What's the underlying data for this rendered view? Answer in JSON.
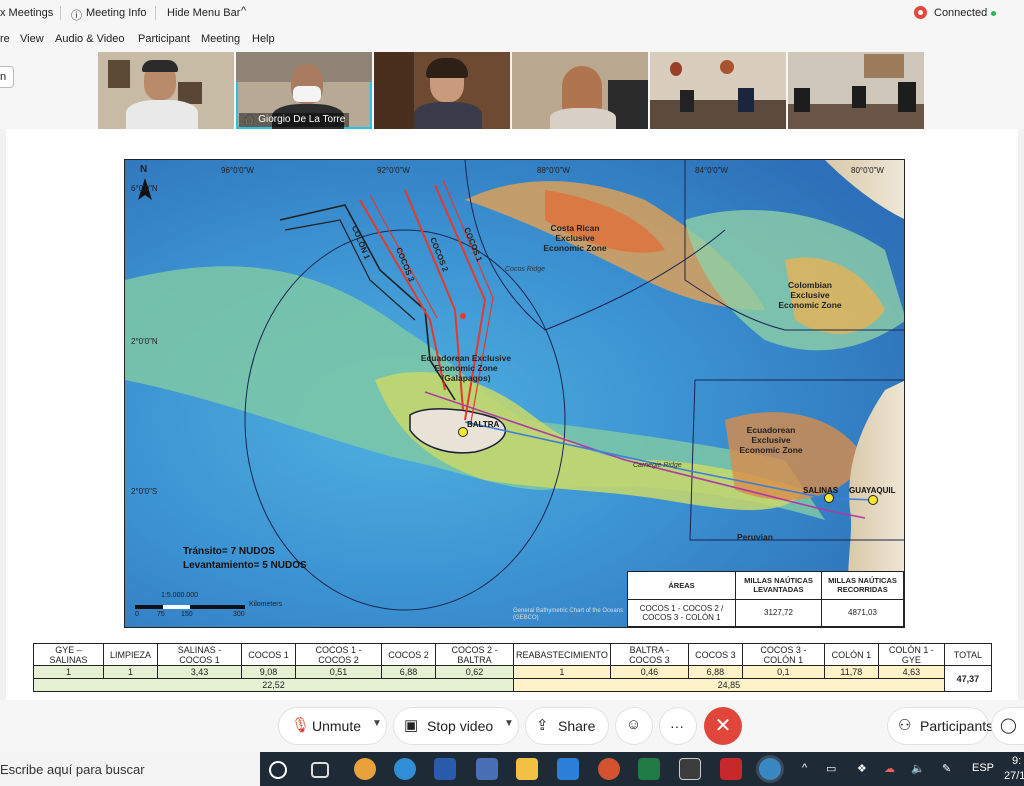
{
  "topbar": {
    "meetings_label": "x Meetings",
    "meeting_info_label": "Meeting Info",
    "hide_menu_label": "Hide Menu Bar",
    "connection_label": "Connected"
  },
  "menubar": {
    "items": [
      "re",
      "View",
      "Audio & Video",
      "Participant",
      "Meeting",
      "Help"
    ]
  },
  "side_button_label": "n",
  "participants": {
    "active_speaker_name": "Giorgio De La Torre"
  },
  "map": {
    "north_label": "N",
    "lon_labels": [
      "96°0'0\"W",
      "92°0'0\"W",
      "88°0'0\"W",
      "84°0'0\"W",
      "80°0'0\"W"
    ],
    "lat_labels": [
      "6°0'0\"N",
      "2°0'0\"N",
      "2°0'0\"S"
    ],
    "zones": {
      "costa_rica": "Costa Rican Exclusive Economic Zone",
      "colombia": "Colombian Exclusive Economic Zone",
      "ecuador_galapagos": "Ecuadorean Exclusive Economic Zone (Galapagos)",
      "ecuador": "Ecuadorean Exclusive Economic Zone",
      "peru": "Peruvian"
    },
    "routes": [
      "COLÓN 1",
      "COCOS 3",
      "COCOS 2",
      "COCOS 1"
    ],
    "ports": [
      "BALTRA",
      "SALINAS",
      "GUAYAQUIL"
    ],
    "ridges": [
      "Cocos Ridge",
      "Carnegie Ridge"
    ],
    "speed_transit": "Tránsito= 7 NUDOS",
    "speed_survey": "Levantamiento= 5 NUDOS",
    "scale": "1:5.000.000",
    "scale_ticks": [
      "0",
      "75",
      "150",
      "300"
    ],
    "scale_unit": "Kilometers",
    "credit": "General Bathymetric Chart of the Oceans (GEBCO)"
  },
  "areas_table": {
    "headers": [
      "ÁREAS",
      "MILLAS NAÚTICAS LEVANTADAS",
      "MILLAS NAÚTICAS RECORRIDAS"
    ],
    "row": [
      "COCOS 1 - COCOS 2 / COCOS 3 - COLÓN 1",
      "3127,72",
      "4871,03"
    ]
  },
  "summary_table": {
    "headers": [
      "GYE – SALINAS",
      "LIMPIEZA",
      "SALINAS - COCOS 1",
      "COCOS 1",
      "COCOS 1 - COCOS 2",
      "COCOS 2",
      "COCOS 2 - BALTRA",
      "REABASTECIMIENTO",
      "BALTRA - COCOS 3",
      "COCOS 3",
      "COCOS 3 - COLÓN 1",
      "COLÓN 1",
      "COLÓN 1 - GYE",
      "TOTAL"
    ],
    "values": [
      "1",
      "1",
      "3,43",
      "9,08",
      "0,51",
      "6,88",
      "0,62",
      "1",
      "0,46",
      "6,88",
      "0,1",
      "11,78",
      "4,63"
    ],
    "subtotal_1": "22,52",
    "subtotal_2": "24,85",
    "total": "47,37"
  },
  "controls": {
    "unmute": "Unmute",
    "stop_video": "Stop video",
    "share": "Share",
    "more": "···",
    "participants": "Participants"
  },
  "taskbar": {
    "search_placeholder": "Escribe aquí para buscar",
    "language": "ESP",
    "time": "9:",
    "date": "27/1"
  },
  "colors": {
    "leave_button": "#e0473a",
    "route_red": "#e33a2c",
    "route_black": "#222222",
    "transit_magenta": "#b03aa8",
    "transit_blue": "#3b7fd8"
  }
}
